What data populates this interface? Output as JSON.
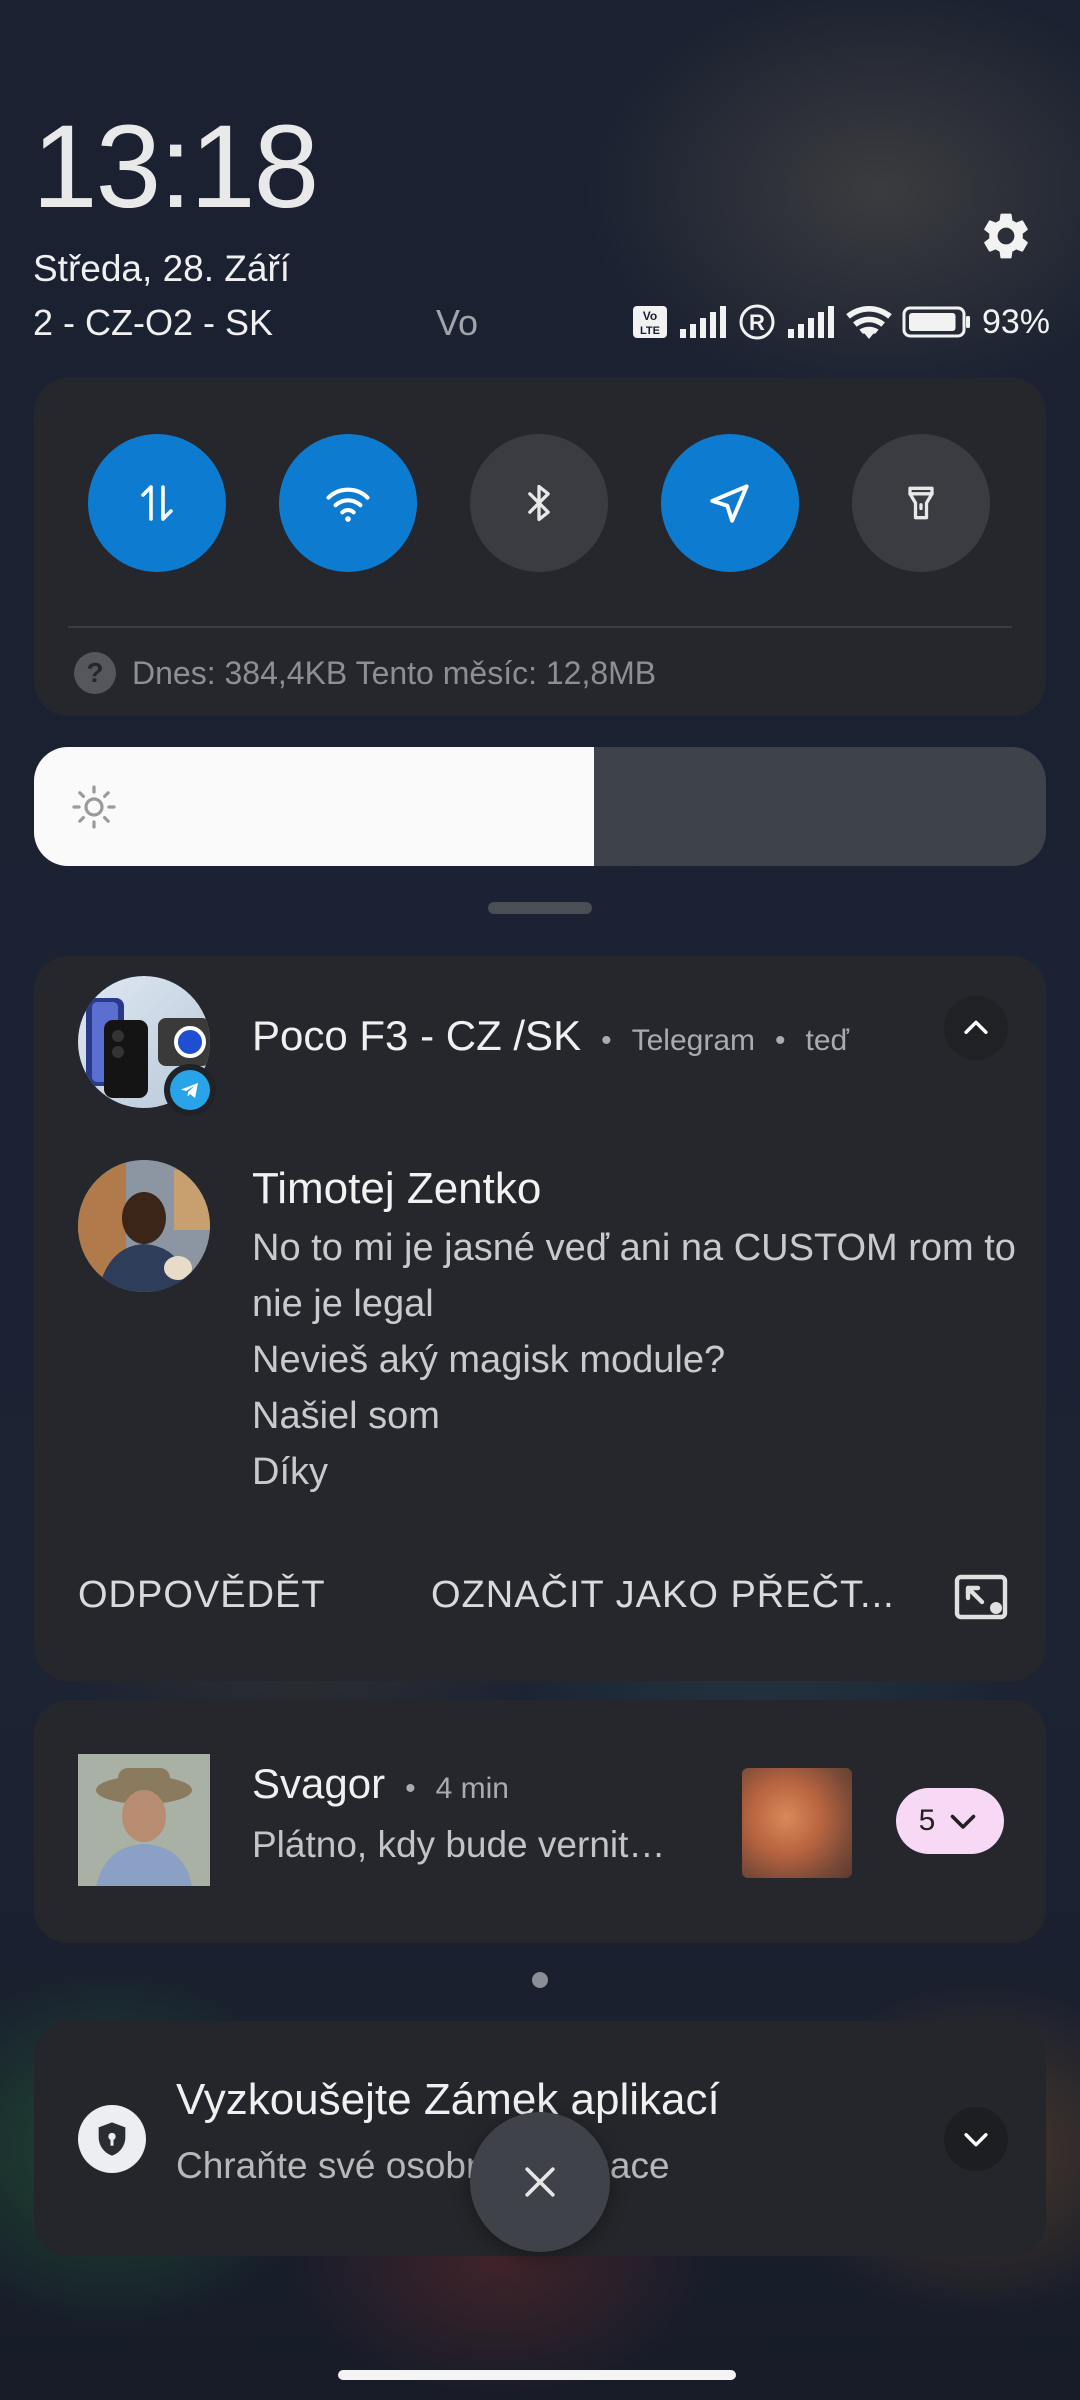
{
  "header": {
    "time": "13:18",
    "date": "Středa, 28. Září",
    "carrier": "2 - CZ-O2 - SK",
    "carrier_secondary": "Vo",
    "battery_percent": "93%",
    "battery_level": 0.93
  },
  "quick_settings": {
    "data_usage": "Dnes: 384,4KB Tento měsíc: 12,8MB",
    "tiles": [
      {
        "name": "mobile-data",
        "icon": "data-arrows-icon",
        "active": true
      },
      {
        "name": "wifi",
        "icon": "wifi-icon",
        "active": true
      },
      {
        "name": "bluetooth",
        "icon": "bluetooth-icon",
        "active": false
      },
      {
        "name": "location",
        "icon": "location-arrow-icon",
        "active": true
      },
      {
        "name": "flashlight",
        "icon": "flashlight-icon",
        "active": false
      }
    ]
  },
  "brightness": {
    "level": 0.553
  },
  "colors": {
    "accent": "#0d7bd0",
    "tile_off": "#3a3c41",
    "card_bg": "#25272c",
    "pill": "#f8d9f5"
  },
  "telegram_notification": {
    "group": "Poco F3 - CZ /SK",
    "app": "Telegram",
    "time": "teď",
    "sender": "Timotej Zentko",
    "messages": [
      "No to mi je jasné veď ani na CUSTOM rom to nie je legal",
      "Nevieš aký magisk module?",
      "Našiel som",
      "Díky"
    ],
    "reply_action": "ODPOVĚDĚT",
    "mark_read_action": "OZNAČIT JAKO PŘEČT..."
  },
  "svagor_notification": {
    "name": "Svagor",
    "time": "4 min",
    "text": "Plátno,  kdy bude vernit…",
    "count": "5"
  },
  "app_lock_notification": {
    "title": "Vyzkoušejte Zámek aplikací",
    "subtitle": "Chraňte své osobní informace"
  }
}
